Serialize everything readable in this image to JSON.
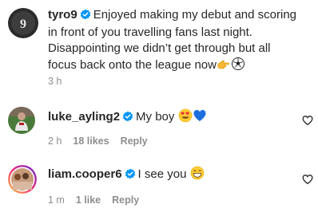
{
  "post": {
    "username": "tyro9",
    "caption": "Enjoyed making my debut and scoring in front of you travelling fans last night. Disappointing we didn’t get through but all focus back onto the league now",
    "caption_lines": [
      "Enjoyed making my debut and scoring",
      "in front of you travelling fans last night.",
      "Disappointing we didn’t get through but all",
      "focus back onto the league now"
    ],
    "timestamp": "3 h",
    "verified": true
  },
  "comments": [
    {
      "username": "luke_ayling2",
      "text": "My boy",
      "timestamp": "2 h",
      "likes": "18 likes",
      "reply_label": "Reply",
      "verified": true,
      "emojis": [
        "heart-eyes-emoji",
        "blue-heart-emoji"
      ]
    },
    {
      "username": "liam.cooper6",
      "text": "I see you",
      "timestamp": "1 m",
      "likes": "1 like",
      "reply_label": "Reply",
      "verified": true,
      "emojis": [
        "grinning-emoji"
      ]
    }
  ],
  "colors": {
    "verified_blue": "#0095f6",
    "text": "#262626",
    "secondary": "#8e8e8e"
  }
}
